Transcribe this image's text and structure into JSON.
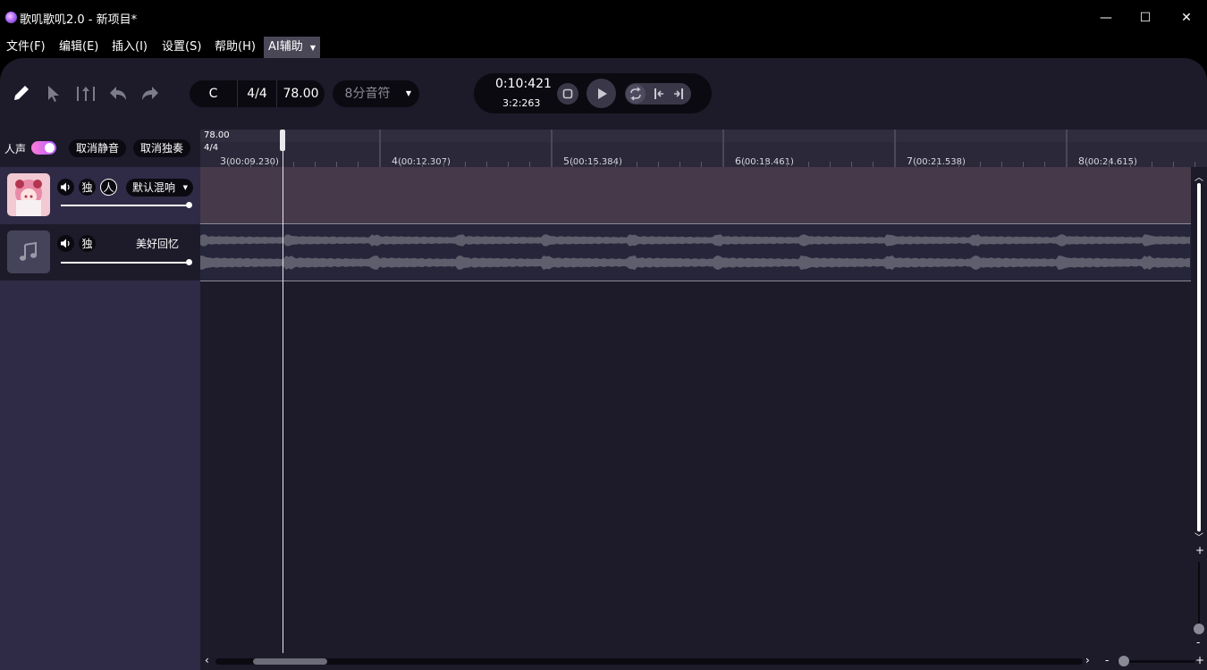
{
  "window": {
    "title": "歌叽歌叽2.0 - 新项目*",
    "controls": {
      "minimize": "—",
      "maximize": "☐",
      "close": "✕"
    }
  },
  "menu": {
    "items": [
      "文件(F)",
      "编辑(E)",
      "插入(I)",
      "设置(S)",
      "帮助(H)"
    ],
    "ai_label": "AI辅助"
  },
  "toolbar": {
    "tools": [
      "pencil-icon",
      "pointer-icon",
      "split-icon",
      "undo-icon",
      "redo-icon"
    ],
    "key": "C",
    "time_signature": "4/4",
    "tempo": "78.00",
    "quantize": "8分音符"
  },
  "transport": {
    "time": "0:10:421",
    "beat_position": "3:2:263"
  },
  "track_controls": {
    "vocal_toggle_label": "人声",
    "unmute_all": "取消静音",
    "unsolo_all": "取消独奏"
  },
  "tracks": [
    {
      "type": "vocal",
      "solo": "独",
      "person": "人",
      "reverb": "默认混响",
      "volume": 1.0
    },
    {
      "type": "audio",
      "solo": "独",
      "name": "美好回忆",
      "volume": 1.0
    }
  ],
  "ruler": {
    "tempo": "78.00",
    "time_signature": "4/4",
    "bars": [
      {
        "n": "3",
        "t": "(00:09.230)"
      },
      {
        "n": "4",
        "t": "(00:12.307)"
      },
      {
        "n": "5",
        "t": "(00:15.384)"
      },
      {
        "n": "6",
        "t": "(00:18.461)"
      },
      {
        "n": "7",
        "t": "(00:21.538)"
      },
      {
        "n": "8",
        "t": "(00:24.615)"
      }
    ]
  },
  "zoom": {
    "plus": "+",
    "minus": "-"
  },
  "colors": {
    "background": "#1d1b2a",
    "track_column": "#2f2b46",
    "vocal_lane": "#463a4a",
    "waveform": "#5f5e6c",
    "toggle_gradient_start": "#ff7bd8",
    "toggle_gradient_end": "#b160ff"
  }
}
